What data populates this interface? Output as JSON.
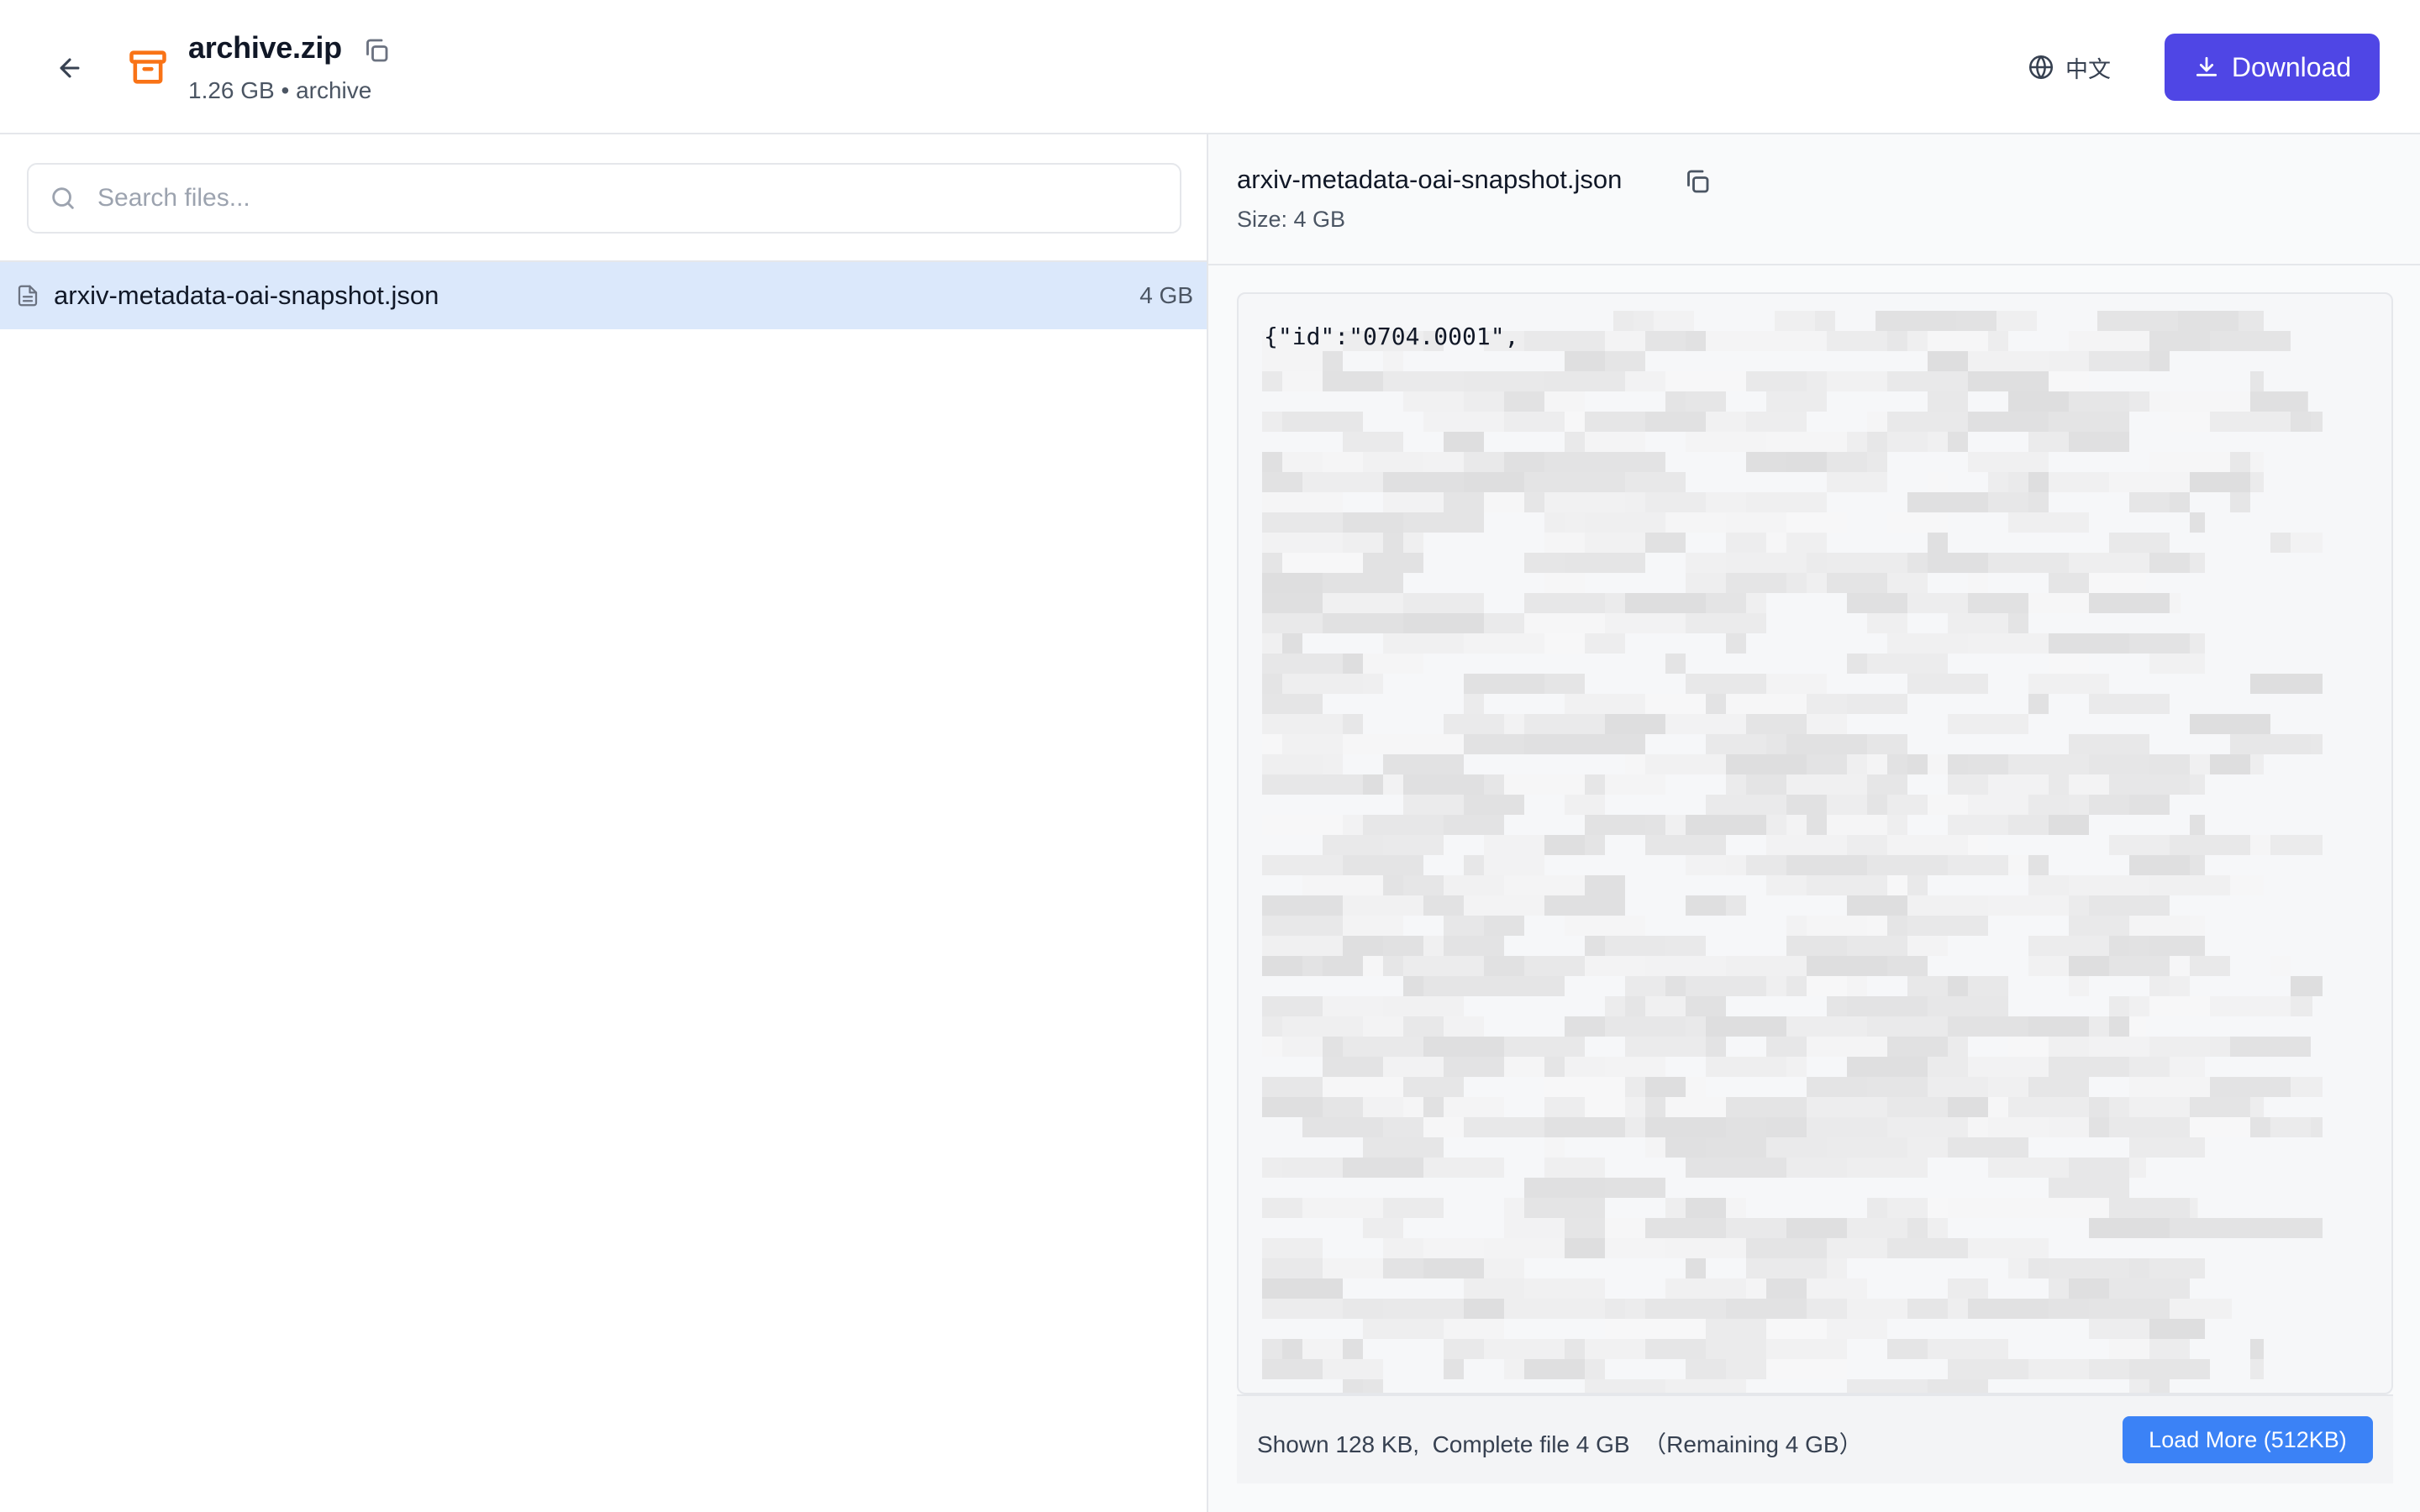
{
  "header": {
    "title": "archive.zip",
    "subtitle": "1.26 GB • archive",
    "language_label": "中文",
    "download_label": "Download",
    "accent_color": "#4f46e5",
    "icons": [
      "back-arrow-icon",
      "archive-box-icon",
      "copy-icon",
      "globe-icon",
      "download-icon"
    ]
  },
  "sidebar": {
    "search": {
      "placeholder": "Search files...",
      "value": ""
    },
    "files": [
      {
        "name": "arxiv-metadata-oai-snapshot.json",
        "size": "4 GB",
        "selected": true
      }
    ]
  },
  "preview": {
    "file_name": "arxiv-metadata-oai-snapshot.json",
    "size_label": "Size: 4 GB",
    "first_line": "{\"id\":\"0704.0001\",",
    "footer": {
      "status": "Shown 128 KB,  Complete file 4 GB  （Remaining 4 GB）",
      "load_more_label": "Load More (512KB)",
      "button_color": "#3b82f6"
    }
  }
}
